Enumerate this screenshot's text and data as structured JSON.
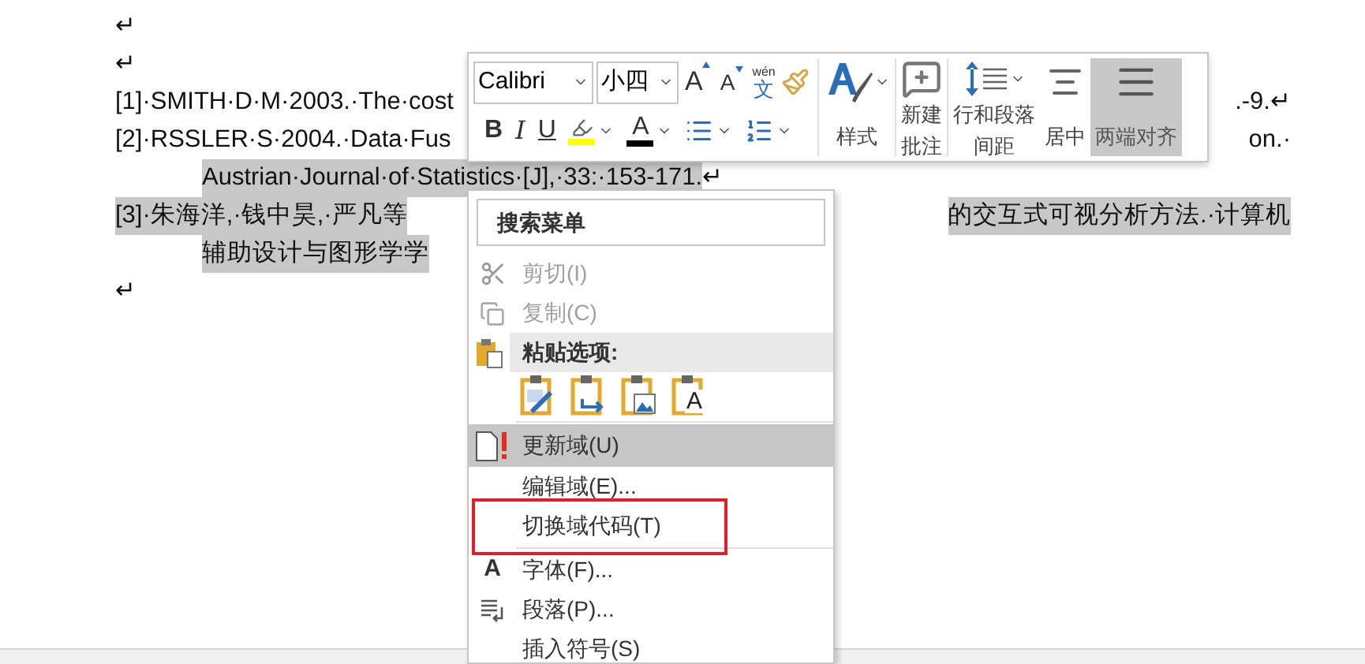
{
  "document": {
    "lines": [
      {
        "left": [
          {
            "text": "↵",
            "highlighted": false
          }
        ]
      },
      {
        "left": [
          {
            "text": "↵",
            "highlighted": false
          }
        ]
      },
      {
        "left": [
          {
            "text": "[1]·SMITH·D·M·2003.·The·cost",
            "highlighted": false
          }
        ],
        "right": [
          {
            "text": ".-9.↵",
            "highlighted": false
          }
        ]
      },
      {
        "left": [
          {
            "text": "[2]·RSSLER·S·2004.·Data·Fus",
            "highlighted": false
          }
        ],
        "right": [
          {
            "text": "on.·",
            "highlighted": false
          }
        ]
      },
      {
        "indent": true,
        "left": [
          {
            "text": "Austrian·Journal·of·Statistics·[J],·33:·153-171.",
            "highlighted": true
          },
          {
            "text": "↵",
            "highlighted": false
          }
        ]
      },
      {
        "left": [
          {
            "text": "[3]·朱海洋,·钱中昊,·严凡等",
            "highlighted": true
          }
        ],
        "right": [
          {
            "text": "的交互式可视分析方法.·计算机",
            "highlighted": true
          }
        ]
      },
      {
        "indent": true,
        "left": [
          {
            "text": "辅助设计与图形学学",
            "highlighted": true
          }
        ]
      },
      {
        "left": [
          {
            "text": "↵",
            "highlighted": false
          }
        ]
      }
    ]
  },
  "mini_toolbar": {
    "font_name": "Calibri",
    "font_size": "小四",
    "grow_font": "A",
    "shrink_font": "A",
    "phonetic_guide": {
      "top": "wén",
      "bottom": "文"
    },
    "format_buttons": [
      {
        "kind": "bold",
        "label": "B"
      },
      {
        "kind": "italic",
        "label": "I"
      },
      {
        "kind": "underline",
        "label": "U"
      },
      {
        "kind": "highlight"
      },
      {
        "kind": "font-color",
        "label": "A"
      },
      {
        "kind": "bullets"
      },
      {
        "kind": "numbering"
      }
    ],
    "big_buttons": [
      {
        "kind": "styles",
        "label": [
          "样式"
        ],
        "selected": false
      },
      {
        "kind": "comment",
        "label": [
          "新建",
          "批注"
        ],
        "selected": false
      },
      {
        "kind": "spacing",
        "label": [
          "行和段落",
          "间距"
        ],
        "selected": false
      },
      {
        "kind": "center",
        "label": [
          "居中"
        ],
        "selected": false
      },
      {
        "kind": "justify",
        "label": [
          "两端对齐"
        ],
        "selected": true
      }
    ]
  },
  "context_menu": {
    "search": {
      "placeholder": "搜索菜单"
    },
    "items": [
      {
        "kind": "item",
        "label": "剪切(I)",
        "disabled": true,
        "selected": false,
        "annotated": false
      },
      {
        "kind": "item",
        "label": "复制(C)",
        "disabled": true,
        "selected": false,
        "annotated": false
      },
      {
        "kind": "header",
        "label": "粘贴选项:"
      },
      {
        "kind": "paste-options",
        "text_option": "A"
      },
      {
        "kind": "separator"
      },
      {
        "kind": "item",
        "label": "更新域(U)",
        "disabled": false,
        "selected": true,
        "annotated": false
      },
      {
        "kind": "item",
        "label": "编辑域(E)...",
        "disabled": false,
        "selected": false,
        "annotated": false
      },
      {
        "kind": "item",
        "label": "切换域代码(T)",
        "disabled": false,
        "selected": false,
        "annotated": true
      },
      {
        "kind": "separator"
      },
      {
        "kind": "item",
        "icon_text": "A",
        "label": "字体(F)...",
        "disabled": false,
        "selected": false,
        "annotated": false
      },
      {
        "kind": "item",
        "label": "段落(P)...",
        "disabled": false,
        "selected": false,
        "annotated": false
      },
      {
        "kind": "item",
        "label": "插入符号(S)",
        "disabled": false,
        "selected": false,
        "annotated": false
      }
    ]
  }
}
